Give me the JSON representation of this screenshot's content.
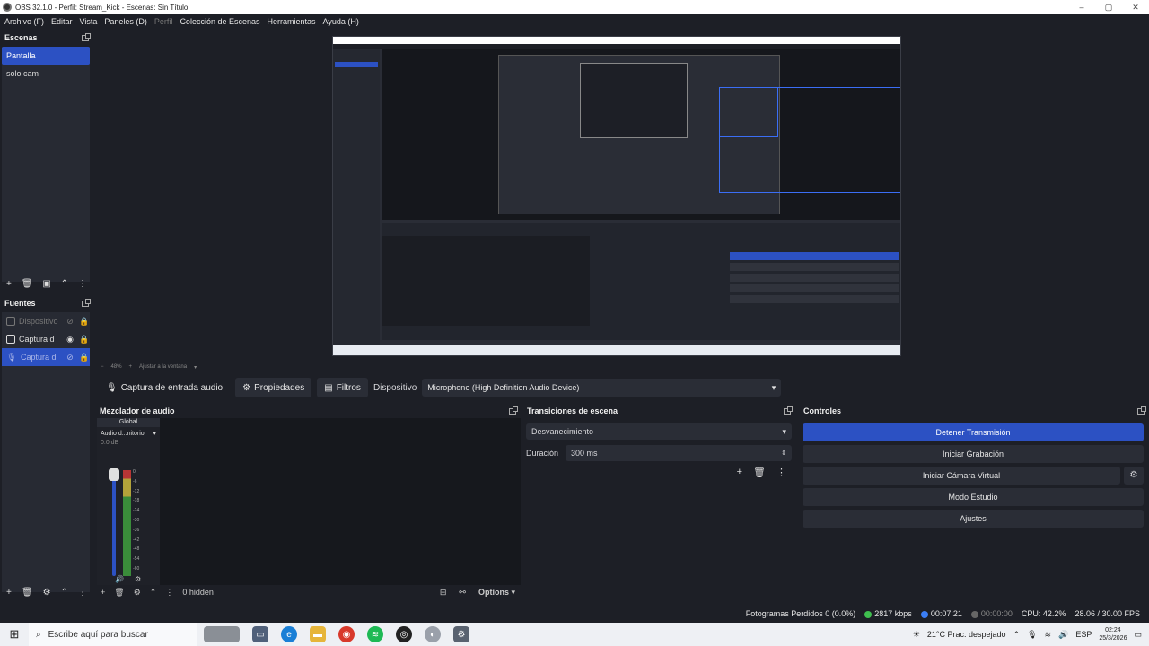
{
  "window": {
    "title": "OBS 32.1.0 - Perfil: Stream_Kick - Escenas: Sin Título",
    "minimize_icon": "–",
    "maximize_icon": "▢",
    "close_icon": "✕"
  },
  "menu": [
    "Archivo (F)",
    "Editar",
    "Vista",
    "Paneles (D)",
    "Perfil",
    "Colección de Escenas",
    "Herramientas",
    "Ayuda (H)"
  ],
  "scenes": {
    "title": "Escenas",
    "items": [
      {
        "label": "Pantalla",
        "active": true
      },
      {
        "label": "solo cam",
        "active": false
      }
    ]
  },
  "sources": {
    "title": "Fuentes",
    "items": [
      {
        "label": "Dispositivo",
        "state": "disabled"
      },
      {
        "label": "Captura d",
        "state": "normal"
      },
      {
        "label": "Captura d",
        "state": "active"
      }
    ]
  },
  "preview_toolbar": {
    "zoom": "48%",
    "fit_label": "Ajustar a la ventana"
  },
  "context_bar": {
    "source_name": "Captura de entrada audio",
    "properties_label": "Propiedades",
    "filters_label": "Filtros",
    "device_label": "Dispositivo",
    "device_value": "Microphone (High Definition Audio Device)"
  },
  "mixer": {
    "title": "Mezclador de audio",
    "channel": {
      "header": "Global",
      "name": "Audio d...nitorio",
      "db": "0.0 dB",
      "scale": [
        "0",
        "-6",
        "-12",
        "-18",
        "-24",
        "-30",
        "-36",
        "-42",
        "-48",
        "-54",
        "-60"
      ]
    },
    "hidden_count": "0 hidden",
    "options_label": "Options"
  },
  "transitions": {
    "title": "Transiciones de escena",
    "selected": "Desvanecimiento",
    "duration_label": "Duración",
    "duration_value": "300 ms"
  },
  "controls": {
    "title": "Controles",
    "buttons": [
      "Detener Transmisión",
      "Iniciar Grabación",
      "Iniciar Cámara Virtual",
      "Modo Estudio",
      "Ajustes"
    ]
  },
  "status": {
    "dropped_frames": "Fotogramas Perdidos 0 (0.0%)",
    "bitrate": "2817 kbps",
    "stream_time": "00:07:21",
    "record_time": "00:00:00",
    "cpu": "CPU: 42.2%",
    "fps": "28.06 / 30.00 FPS",
    "colors": {
      "bitrate": "#3fbf4f",
      "stream": "#3b7ef5",
      "record": "#666666"
    }
  },
  "taskbar": {
    "search_placeholder": "Escribe aquí para buscar",
    "weather": "21°C  Prac. despejado",
    "language": "ESP",
    "time": "02:24",
    "date": "25/3/2026"
  }
}
